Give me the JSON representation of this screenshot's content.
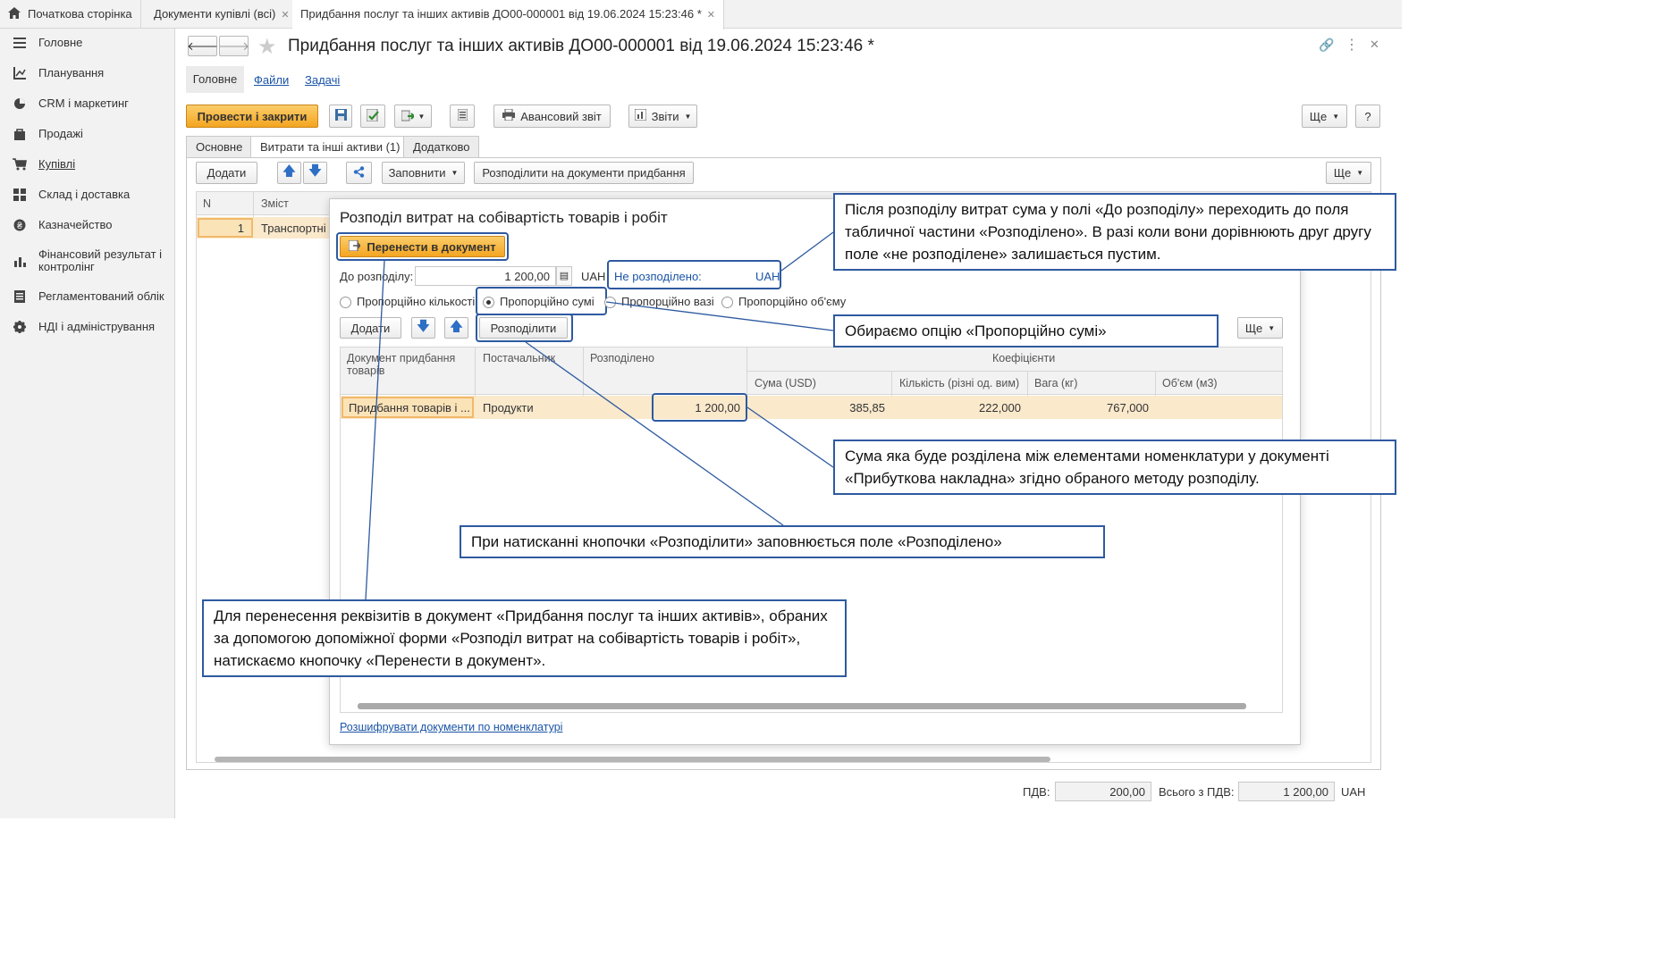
{
  "tabs": [
    {
      "label": "Початкова сторінка"
    },
    {
      "label": "Документи купівлі (всі)"
    },
    {
      "label": "Придбання послуг та інших активів ДО00-000001 від 19.06.2024 15:23:46 *"
    }
  ],
  "sidebar": {
    "items": [
      {
        "label": "Головне",
        "icon": "menu-icon"
      },
      {
        "label": "Планування",
        "icon": "chart-axes-icon"
      },
      {
        "label": "CRM і маркетинг",
        "icon": "pie-chart-icon"
      },
      {
        "label": "Продажі",
        "icon": "bag-icon"
      },
      {
        "label": "Купівлі",
        "icon": "cart-icon"
      },
      {
        "label": "Склад і доставка",
        "icon": "grid-icon"
      },
      {
        "label": "Казначейство",
        "icon": "coin-icon"
      },
      {
        "label": "Фінансовий результат і контролінг",
        "icon": "bar-chart-icon"
      },
      {
        "label": "Регламентований облік",
        "icon": "document-icon"
      },
      {
        "label": "НДІ і адміністрування",
        "icon": "gear-icon"
      }
    ]
  },
  "doc": {
    "title": "Придбання послуг та інших активів ДО00-000001 від 19.06.2024 15:23:46 *",
    "nav": {
      "main": "Головне",
      "files": "Файли",
      "tasks": "Задачі"
    },
    "toolbar": {
      "post_close": "Провести і закрити",
      "advance_report": "Авансовий звіт",
      "reports": "Звіти",
      "more": "Ще",
      "help": "?"
    },
    "page_tabs": [
      "Основне",
      "Витрати та інші активи (1)",
      "Додатково"
    ],
    "grid_toolbar": {
      "add": "Додати",
      "fill": "Заповнити",
      "distribute": "Розподілити на документи придбання",
      "more": "Ще"
    },
    "grid": {
      "headers": [
        "N",
        "Зміст"
      ],
      "rows": [
        {
          "n": "1",
          "content": "Транспортні п"
        }
      ]
    }
  },
  "footer": {
    "vat_label": "ПДВ:",
    "vat_value": "200,00",
    "total_label": "Всього з ПДВ:",
    "total_value": "1 200,00",
    "currency": "UAH"
  },
  "dialog": {
    "title": "Розподіл витрат на собівартість товарів і робіт",
    "transfer_button": "Перенести в документ",
    "to_distribute_label": "До розподілу:",
    "to_distribute_value": "1 200,00",
    "currency": "UAH",
    "not_distributed_label": "Не розподілено:",
    "not_distributed_currency": "UAH",
    "methods": [
      "Пропорційно кількості",
      "Пропорційно сумі",
      "Пропорційно вазі",
      "Пропорційно об'єму"
    ],
    "selected_method": "Пропорційно сумі",
    "add_button": "Додати",
    "distribute_button": "Розподілити",
    "more_button": "Ще",
    "columns": {
      "doc": "Документ придбання товарів",
      "supplier": "Постачальник",
      "distributed": "Розподілено",
      "coef": "Коефіцієнти",
      "sum": "Сума (USD)",
      "qty": "Кількість (різні од. вим)",
      "weight": "Вага (кг)",
      "volume": "Об'єм (м3)"
    },
    "row": {
      "doc": "Придбання товарів і ...",
      "supplier": "Продукти",
      "distributed": "1 200,00",
      "sum": "385,85",
      "qty": "222,000",
      "weight": "767,000",
      "volume": ""
    },
    "decode_link": "Розшифрувати документи по номенклатурі"
  },
  "callouts": {
    "c1": "Після розподілу витрат сума у полі «До розподілу» переходить до поля табличної частини «Розподілено». В разі коли вони дорівнюють друг другу поле «не розподілене» залишається пустим.",
    "c2": "Обираємо опцію «Пропорційно сумі»",
    "c3": "Сума яка буде розділена між елементами номенклатури у документі «Прибуткова накладна» згідно обраного методу розподілу.",
    "c4": "При натисканні кнопочки «Розподілити» заповнюється поле «Розподілено»",
    "c5": "Для перенесення реквізитів в документ «Придбання послуг та інших активів», обраних за допомогою допоміжної форми «Розподіл витрат на собівартість товарів і робіт», натискаємо кнопочку «Перенести в документ»."
  },
  "colors": {
    "accent": "#f4a521",
    "callout_border": "#2e5aa0",
    "link": "#1a54a6"
  }
}
